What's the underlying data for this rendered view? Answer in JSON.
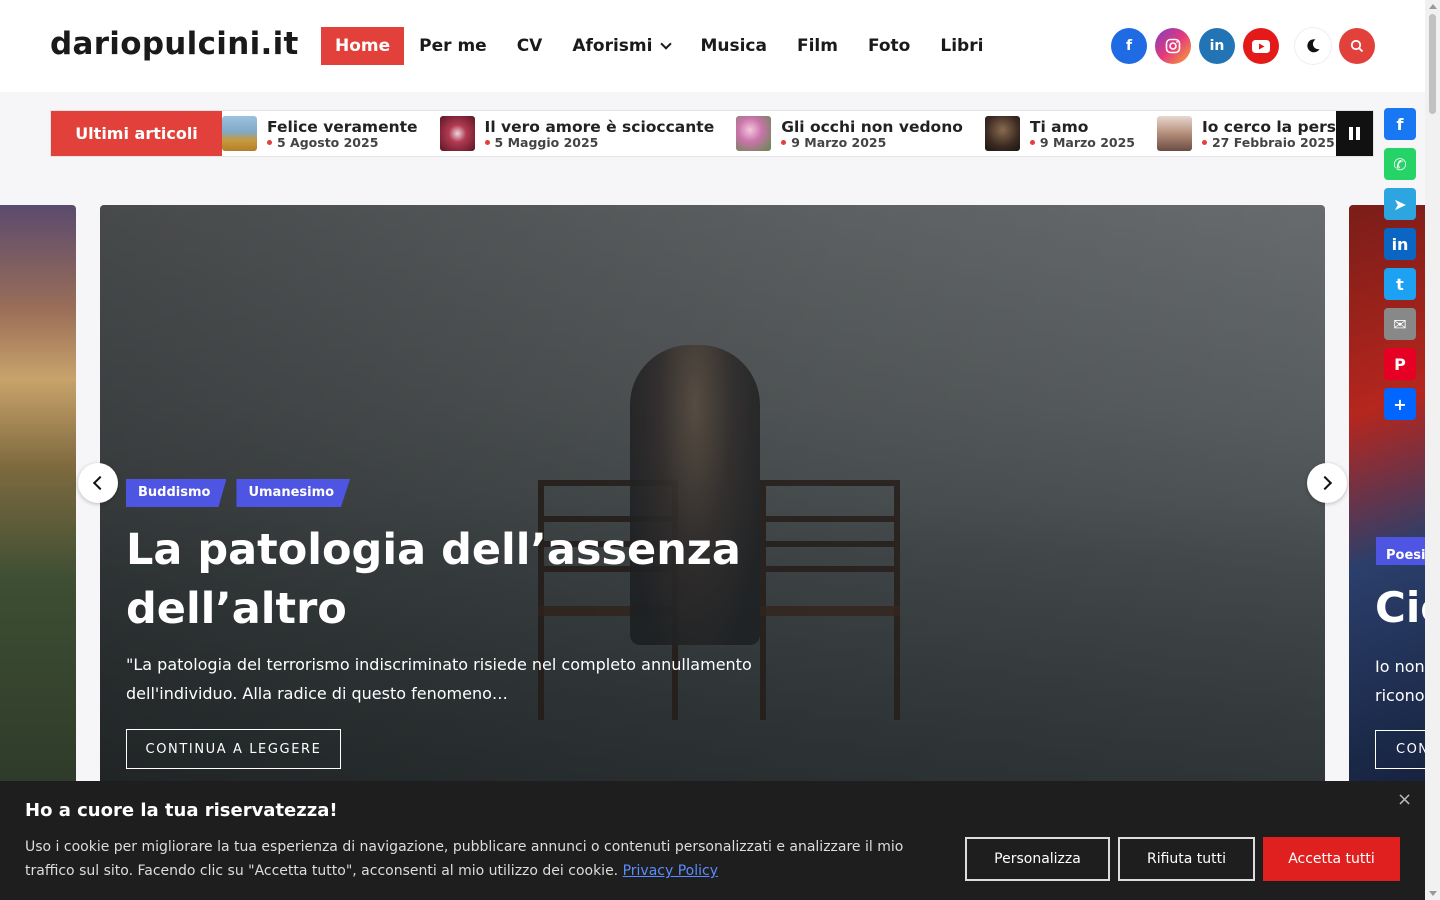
{
  "site": {
    "logo": "dariopulcini.it"
  },
  "nav": {
    "items": [
      {
        "label": "Home",
        "active": true
      },
      {
        "label": "Per me"
      },
      {
        "label": "CV"
      },
      {
        "label": "Aforismi",
        "has_dropdown": true
      },
      {
        "label": "Musica"
      },
      {
        "label": "Film"
      },
      {
        "label": "Foto"
      },
      {
        "label": "Libri"
      }
    ]
  },
  "header_icons": {
    "socials": [
      {
        "name": "facebook-icon",
        "glyph": "f"
      },
      {
        "name": "instagram-icon",
        "glyph": "◎"
      },
      {
        "name": "linkedin-icon",
        "glyph": "in"
      },
      {
        "name": "youtube-icon",
        "glyph": "▶"
      }
    ],
    "dark_mode_icon": "moon-icon",
    "search_icon": "search-icon"
  },
  "ticker": {
    "label": "Ultimi articoli",
    "items": [
      {
        "title": "Felice veramente",
        "date": "5 Agosto 2025",
        "thumb_color": "#7fa9c7"
      },
      {
        "title": "Il vero amore è scioccante",
        "date": "5 Maggio 2025",
        "thumb_color": "#8a2a3a"
      },
      {
        "title": "Gli occhi non vedono",
        "date": "9 Marzo 2025",
        "thumb_color": "#c974a9"
      },
      {
        "title": "Ti amo",
        "date": "9 Marzo 2025",
        "thumb_color": "#3b2a22"
      },
      {
        "title": "Io cerco la persona",
        "date": "27 Febbraio 2025",
        "thumb_color": "#b58e7a"
      }
    ]
  },
  "slider": {
    "main": {
      "tags": [
        "Buddismo",
        "Umanesimo"
      ],
      "title": "La patologia dell’assenza dell’altro",
      "excerpt": "\"La patologia del terrorismo indiscriminato risiede nel completo annullamento dell'individuo. Alla radice di questo fenomeno…",
      "button": "CONTINUA A LEGGERE"
    },
    "next_peek": {
      "tag": "Poesi",
      "title": "Cio",
      "excerpt_line1": "Io non",
      "excerpt_line2": "ricono",
      "button": "CON"
    }
  },
  "share_bar": [
    {
      "name": "facebook-share-icon",
      "glyph": "f",
      "color": "#1877f2"
    },
    {
      "name": "whatsapp-share-icon",
      "glyph": "✆",
      "color": "#25d366"
    },
    {
      "name": "telegram-share-icon",
      "glyph": "➤",
      "color": "#2ca5e0"
    },
    {
      "name": "linkedin-share-icon",
      "glyph": "in",
      "color": "#0a66c2"
    },
    {
      "name": "twitter-share-icon",
      "glyph": "t",
      "color": "#1da1f2"
    },
    {
      "name": "email-share-icon",
      "glyph": "✉",
      "color": "#888888"
    },
    {
      "name": "pinterest-share-icon",
      "glyph": "P",
      "color": "#e60023"
    },
    {
      "name": "more-share-icon",
      "glyph": "+",
      "color": "#0166ff"
    }
  ],
  "cookie": {
    "title": "Ho a cuore la tua riservatezza!",
    "text": "Uso i cookie per migliorare la tua esperienza di navigazione, pubblicare annunci o contenuti personalizzati e analizzare il mio traffico sul sito. Facendo clic su \"Accetta tutto\", acconsenti al mio utilizzo dei cookie.",
    "privacy_link": "Privacy Policy",
    "close": "×",
    "buttons": {
      "customize": "Personalizza",
      "reject": "Rifiuta tutti",
      "accept": "Accetta tutti"
    }
  }
}
